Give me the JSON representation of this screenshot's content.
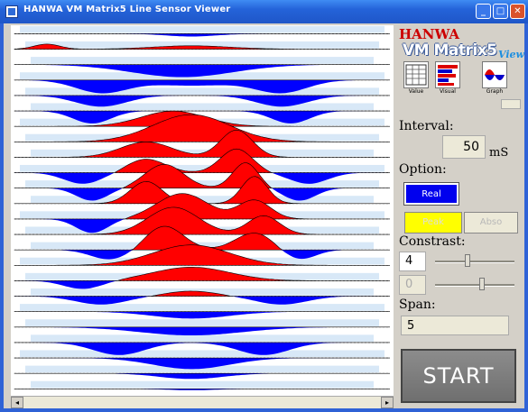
{
  "window": {
    "title": "HANWA VM Matrix5 Line Sensor Viewer",
    "minimize_label": "_",
    "maximize_label": "□",
    "close_label": "✕"
  },
  "panel": {
    "brand": "HANWA",
    "product": "VM Matrix5",
    "product_suffix": "View",
    "modes": [
      {
        "label": "Value",
        "icon": "value-grid-icon"
      },
      {
        "label": "Visual",
        "icon": "visual-bars-icon"
      },
      {
        "label": "Graph",
        "icon": "graph-wave-icon"
      }
    ],
    "interval_label": "Interval:",
    "interval_value": "50",
    "interval_unit": "mS",
    "option_label": "Option:",
    "real_label": "Real",
    "peak_label": "Peak",
    "abso_label": "Abso",
    "constrast_label": "Constrast:",
    "constrast_value": "4",
    "constrast_level": 0.4,
    "secondary_value": "0",
    "secondary_level": 0.6,
    "span_label": "Span:",
    "span_value": "5",
    "start_label": "START"
  },
  "colors": {
    "sensor_positive": "#ff0000",
    "sensor_negative": "#0000ff",
    "sensor_background_dots": "#b8d6f0",
    "real_button": "#0000ee",
    "peak_button": "#ffff00"
  },
  "scrollbar": {
    "left_arrow": "◂",
    "right_arrow": "▸"
  }
}
